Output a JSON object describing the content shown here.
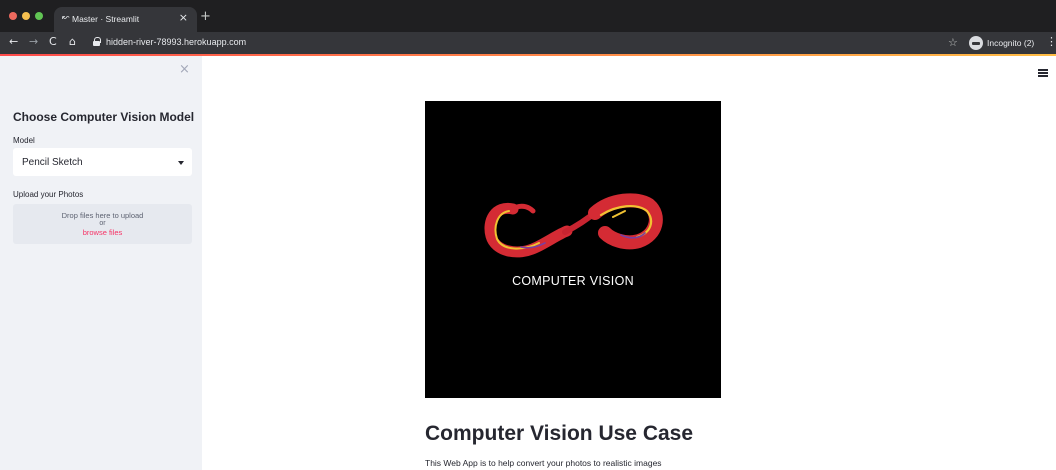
{
  "browser": {
    "tab_title": "Master · Streamlit",
    "tab_close": "×",
    "new_tab": "+",
    "url": "hidden-river-78993.herokuapp.com",
    "profile_label": "Incognito (2)",
    "icons": {
      "back": "←",
      "forward": "→",
      "reload": "C",
      "home": "⌂",
      "star": "☆",
      "menu": "⋮",
      "favicon": "↜"
    },
    "traffic_colors": [
      "#ed6a5e",
      "#f5bf4f",
      "#61c554"
    ]
  },
  "sidebar": {
    "close_icon": "×",
    "heading": "Choose Computer Vision Model",
    "model_label": "Model",
    "model_selected": "Pencil Sketch",
    "upload_label": "Upload your Photos",
    "dropzone": {
      "text": "Drop files here to upload",
      "or": "or",
      "browse": "browse files"
    }
  },
  "main": {
    "hero_caption": "COMPUTER VISION",
    "title": "Computer Vision Use Case",
    "description": "This Web App is to help convert your photos to realistic images"
  },
  "colors": {
    "accent": "#f63366",
    "sidebar_bg": "#f0f2f6",
    "text": "#262730"
  }
}
